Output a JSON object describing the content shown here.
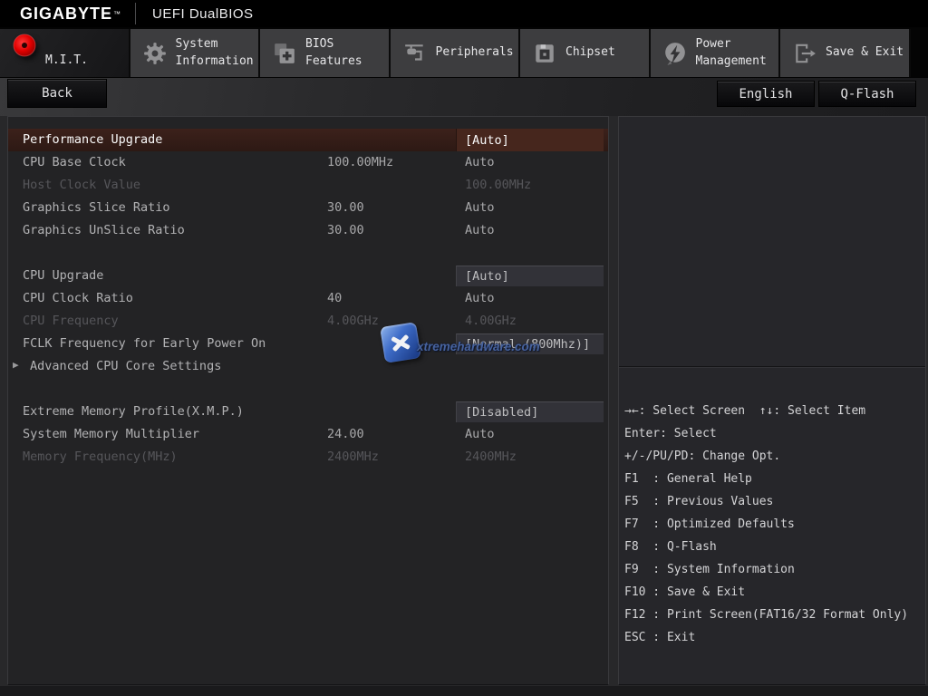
{
  "header": {
    "brand": "GIGABYTE",
    "brand_tm": "™",
    "title": "UEFI DualBIOS"
  },
  "tabs": [
    {
      "label": "M.I.T.",
      "active": true
    },
    {
      "label": "System Information",
      "active": false
    },
    {
      "label": "BIOS Features",
      "active": false
    },
    {
      "label": "Peripherals",
      "active": false
    },
    {
      "label": "Chipset",
      "active": false
    },
    {
      "label": "Power Management",
      "active": false
    },
    {
      "label": "Save & Exit",
      "active": false
    }
  ],
  "toolbar": {
    "back_label": "Back",
    "language_label": "English",
    "qflash_label": "Q-Flash"
  },
  "settings": {
    "rows": [
      {
        "label": "Performance Upgrade",
        "mid": "",
        "value": "[Auto]",
        "state": "selected"
      },
      {
        "label": "CPU Base Clock",
        "mid": "100.00MHz",
        "value": "Auto",
        "state": "normal"
      },
      {
        "label": "Host Clock Value",
        "mid": "",
        "value": "100.00MHz",
        "state": "disabled"
      },
      {
        "label": "Graphics Slice Ratio",
        "mid": "30.00",
        "value": "Auto",
        "state": "normal"
      },
      {
        "label": "Graphics UnSlice Ratio",
        "mid": "30.00",
        "value": "Auto",
        "state": "normal"
      },
      {
        "label": "CPU Upgrade",
        "mid": "",
        "value": "[Auto]",
        "state": "boxed"
      },
      {
        "label": "CPU Clock Ratio",
        "mid": "40",
        "value": "Auto",
        "state": "normal"
      },
      {
        "label": "CPU Frequency",
        "mid": "4.00GHz",
        "value": "4.00GHz",
        "state": "disabled"
      },
      {
        "label": "FCLK Frequency for Early Power On",
        "mid": "",
        "value": "[Normal (800Mhz)]",
        "state": "boxed"
      },
      {
        "label": "Advanced CPU Core Settings",
        "mid": "",
        "value": "",
        "state": "submenu",
        "arrow": "▶"
      },
      {
        "label": "Extreme Memory Profile(X.M.P.)",
        "mid": "",
        "value": "[Disabled]",
        "state": "boxed"
      },
      {
        "label": "System Memory Multiplier",
        "mid": "24.00",
        "value": "Auto",
        "state": "normal"
      },
      {
        "label": "Memory Frequency(MHz)",
        "mid": "2400MHz",
        "value": "2400MHz",
        "state": "disabled"
      }
    ]
  },
  "help": {
    "lines": [
      "→←: Select Screen  ↑↓: Select Item",
      "Enter: Select",
      "+/-/PU/PD: Change Opt.",
      "F1  : General Help",
      "F5  : Previous Values",
      "F7  : Optimized Defaults",
      "F8  : Q-Flash",
      "F9  : System Information",
      "F10 : Save & Exit",
      "F12 : Print Screen(FAT16/32 Format Only)",
      "ESC : Exit"
    ]
  },
  "watermark": {
    "text": "xtremehardware.com"
  },
  "colors": {
    "accent_red": "#e00000",
    "highlight_row": "#331d17",
    "panel_bg": "#232325",
    "tab_inactive": "#3d3d3f",
    "watermark_blue": "#3e6cc8"
  }
}
